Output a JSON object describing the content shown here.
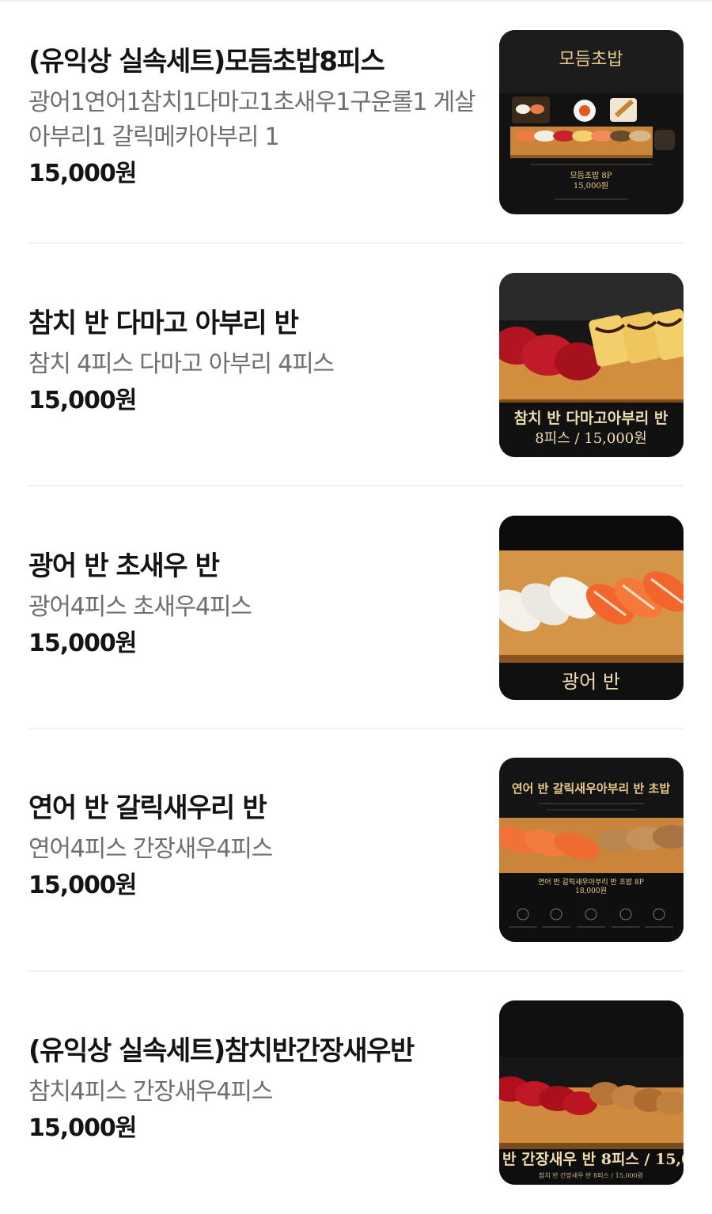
{
  "menu_items": [
    {
      "title": "(유익상 실속세트)모듬초밥8피스",
      "description": "광어1연어1참치1다마고1초새우1구운롤1 게살아부리1 갈릭메카아부리 1",
      "price": "15,000원",
      "image": {
        "heading": "모듬초밥",
        "caption_name": "모듬초밥 8P",
        "caption_price": "15,000원",
        "icon": "assorted-sushi-photo"
      }
    },
    {
      "title": "참치 반 다마고 아부리 반",
      "description": "참치 4피스 다마고 아부리 4피스",
      "price": "15,000원",
      "image": {
        "caption_line1": "참치 반 다마고아부리 반",
        "caption_line2": "8피스 / 15,000원",
        "icon": "tuna-tamago-sushi-photo"
      }
    },
    {
      "title": "광어 반 초새우 반",
      "description": "광어4피스 초새우4피스",
      "price": "15,000원",
      "image": {
        "caption_line1": "광어 반",
        "icon": "flounder-shrimp-sushi-photo"
      }
    },
    {
      "title": "연어 반 갈릭새우리 반",
      "description": "연어4피스 간장새우4피스",
      "price": "15,000원",
      "image": {
        "heading": "연어 반 갈릭새우아부리 반 초밥",
        "caption_name": "연어 반 갈릭새우아부리 반 초밥 8P",
        "caption_price": "18,000원",
        "icon": "salmon-garlic-shrimp-sushi-photo"
      }
    },
    {
      "title": "(유익상 실속세트)참치반간장새우반",
      "description": "참치4피스 간장새우4피스",
      "price": "15,000원",
      "image": {
        "caption_line1": "반 간장새우 반 8피스 / 15,0",
        "caption_line2": "참치 반 간장새우 반 8피스 / 15,000원",
        "icon": "tuna-soy-shrimp-sushi-photo"
      }
    }
  ],
  "colors": {
    "title": "#141414",
    "description": "#6f6f6f",
    "divider": "#f1f1f1",
    "image_gold": "#e9c98a",
    "board_wood": "#c9863a"
  }
}
